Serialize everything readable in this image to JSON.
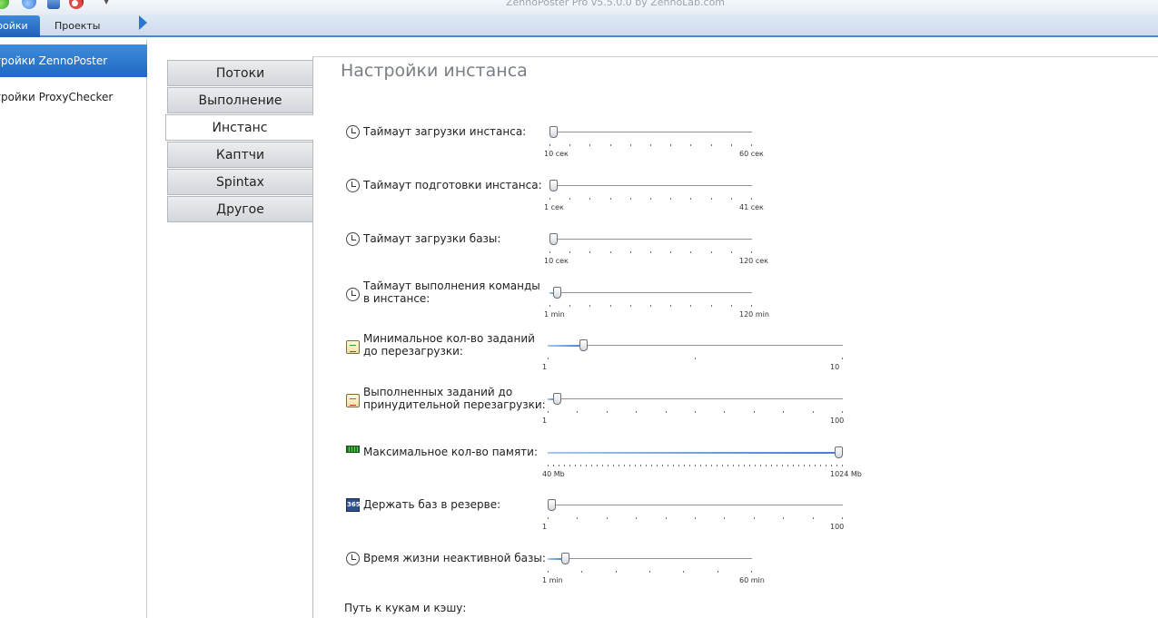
{
  "window": {
    "title": "ZennoPoster Pro v5.5.0.0 by ZennoLab.com"
  },
  "ribbon": {
    "tabs": [
      {
        "label": "ройки"
      },
      {
        "label": "Проекты"
      }
    ]
  },
  "sidebar": {
    "items": [
      {
        "label": "тройки ZennoPoster"
      },
      {
        "label": "тройки ProxyChecker"
      }
    ]
  },
  "tabs": [
    {
      "label": "Потоки"
    },
    {
      "label": "Выполнение"
    },
    {
      "label": "Инстанс"
    },
    {
      "label": "Каптчи"
    },
    {
      "label": "Spintax"
    },
    {
      "label": "Другое"
    }
  ],
  "active_tab": "Инстанс",
  "panel": {
    "title": "Настройки инстанса",
    "settings": [
      {
        "icon": "clock-icon",
        "label": "Таймаут загрузки инстанса:",
        "min_label": "10 сек",
        "max_label": "60 сек",
        "position": 0.0
      },
      {
        "icon": "clock-icon",
        "label": "Таймаут подготовки инстанса:",
        "min_label": "1 сек",
        "max_label": "41 сек",
        "position": 0.0
      },
      {
        "icon": "clock-icon",
        "label": "Таймаут загрузки базы:",
        "min_label": "10 сек",
        "max_label": "120 сек",
        "position": 0.0
      },
      {
        "icon": "clock-icon",
        "label": "Таймаут выполнения команды\nв инстансе:",
        "min_label": "1 min",
        "max_label": "120 min",
        "position": 0.02
      },
      {
        "icon": "clipboard-icon",
        "label": "Минимальное кол-во заданий\nдо перезагрузки:",
        "min_label": "1",
        "max_label": "10",
        "position": 0.11
      },
      {
        "icon": "clipboard-icon",
        "label": "Выполненных заданий до\nпринудительной перезагрузки:",
        "min_label": "1",
        "max_label": "100",
        "position": 0.02
      },
      {
        "icon": "memory-icon",
        "label": "Максимальное кол-во памяти:",
        "min_label": "40 Mb",
        "max_label": "1024 Mb",
        "position": 1.0
      },
      {
        "icon": "calendar-365-icon",
        "label": "Держать баз в резерве:",
        "min_label": "1",
        "max_label": "100",
        "position": 0.0
      },
      {
        "icon": "clock-icon",
        "label": "Время жизни неактивной базы:",
        "min_label": "1 min",
        "max_label": "60 min",
        "position": 0.07
      }
    ],
    "path_label": "Путь к кукам и кэшу:"
  }
}
